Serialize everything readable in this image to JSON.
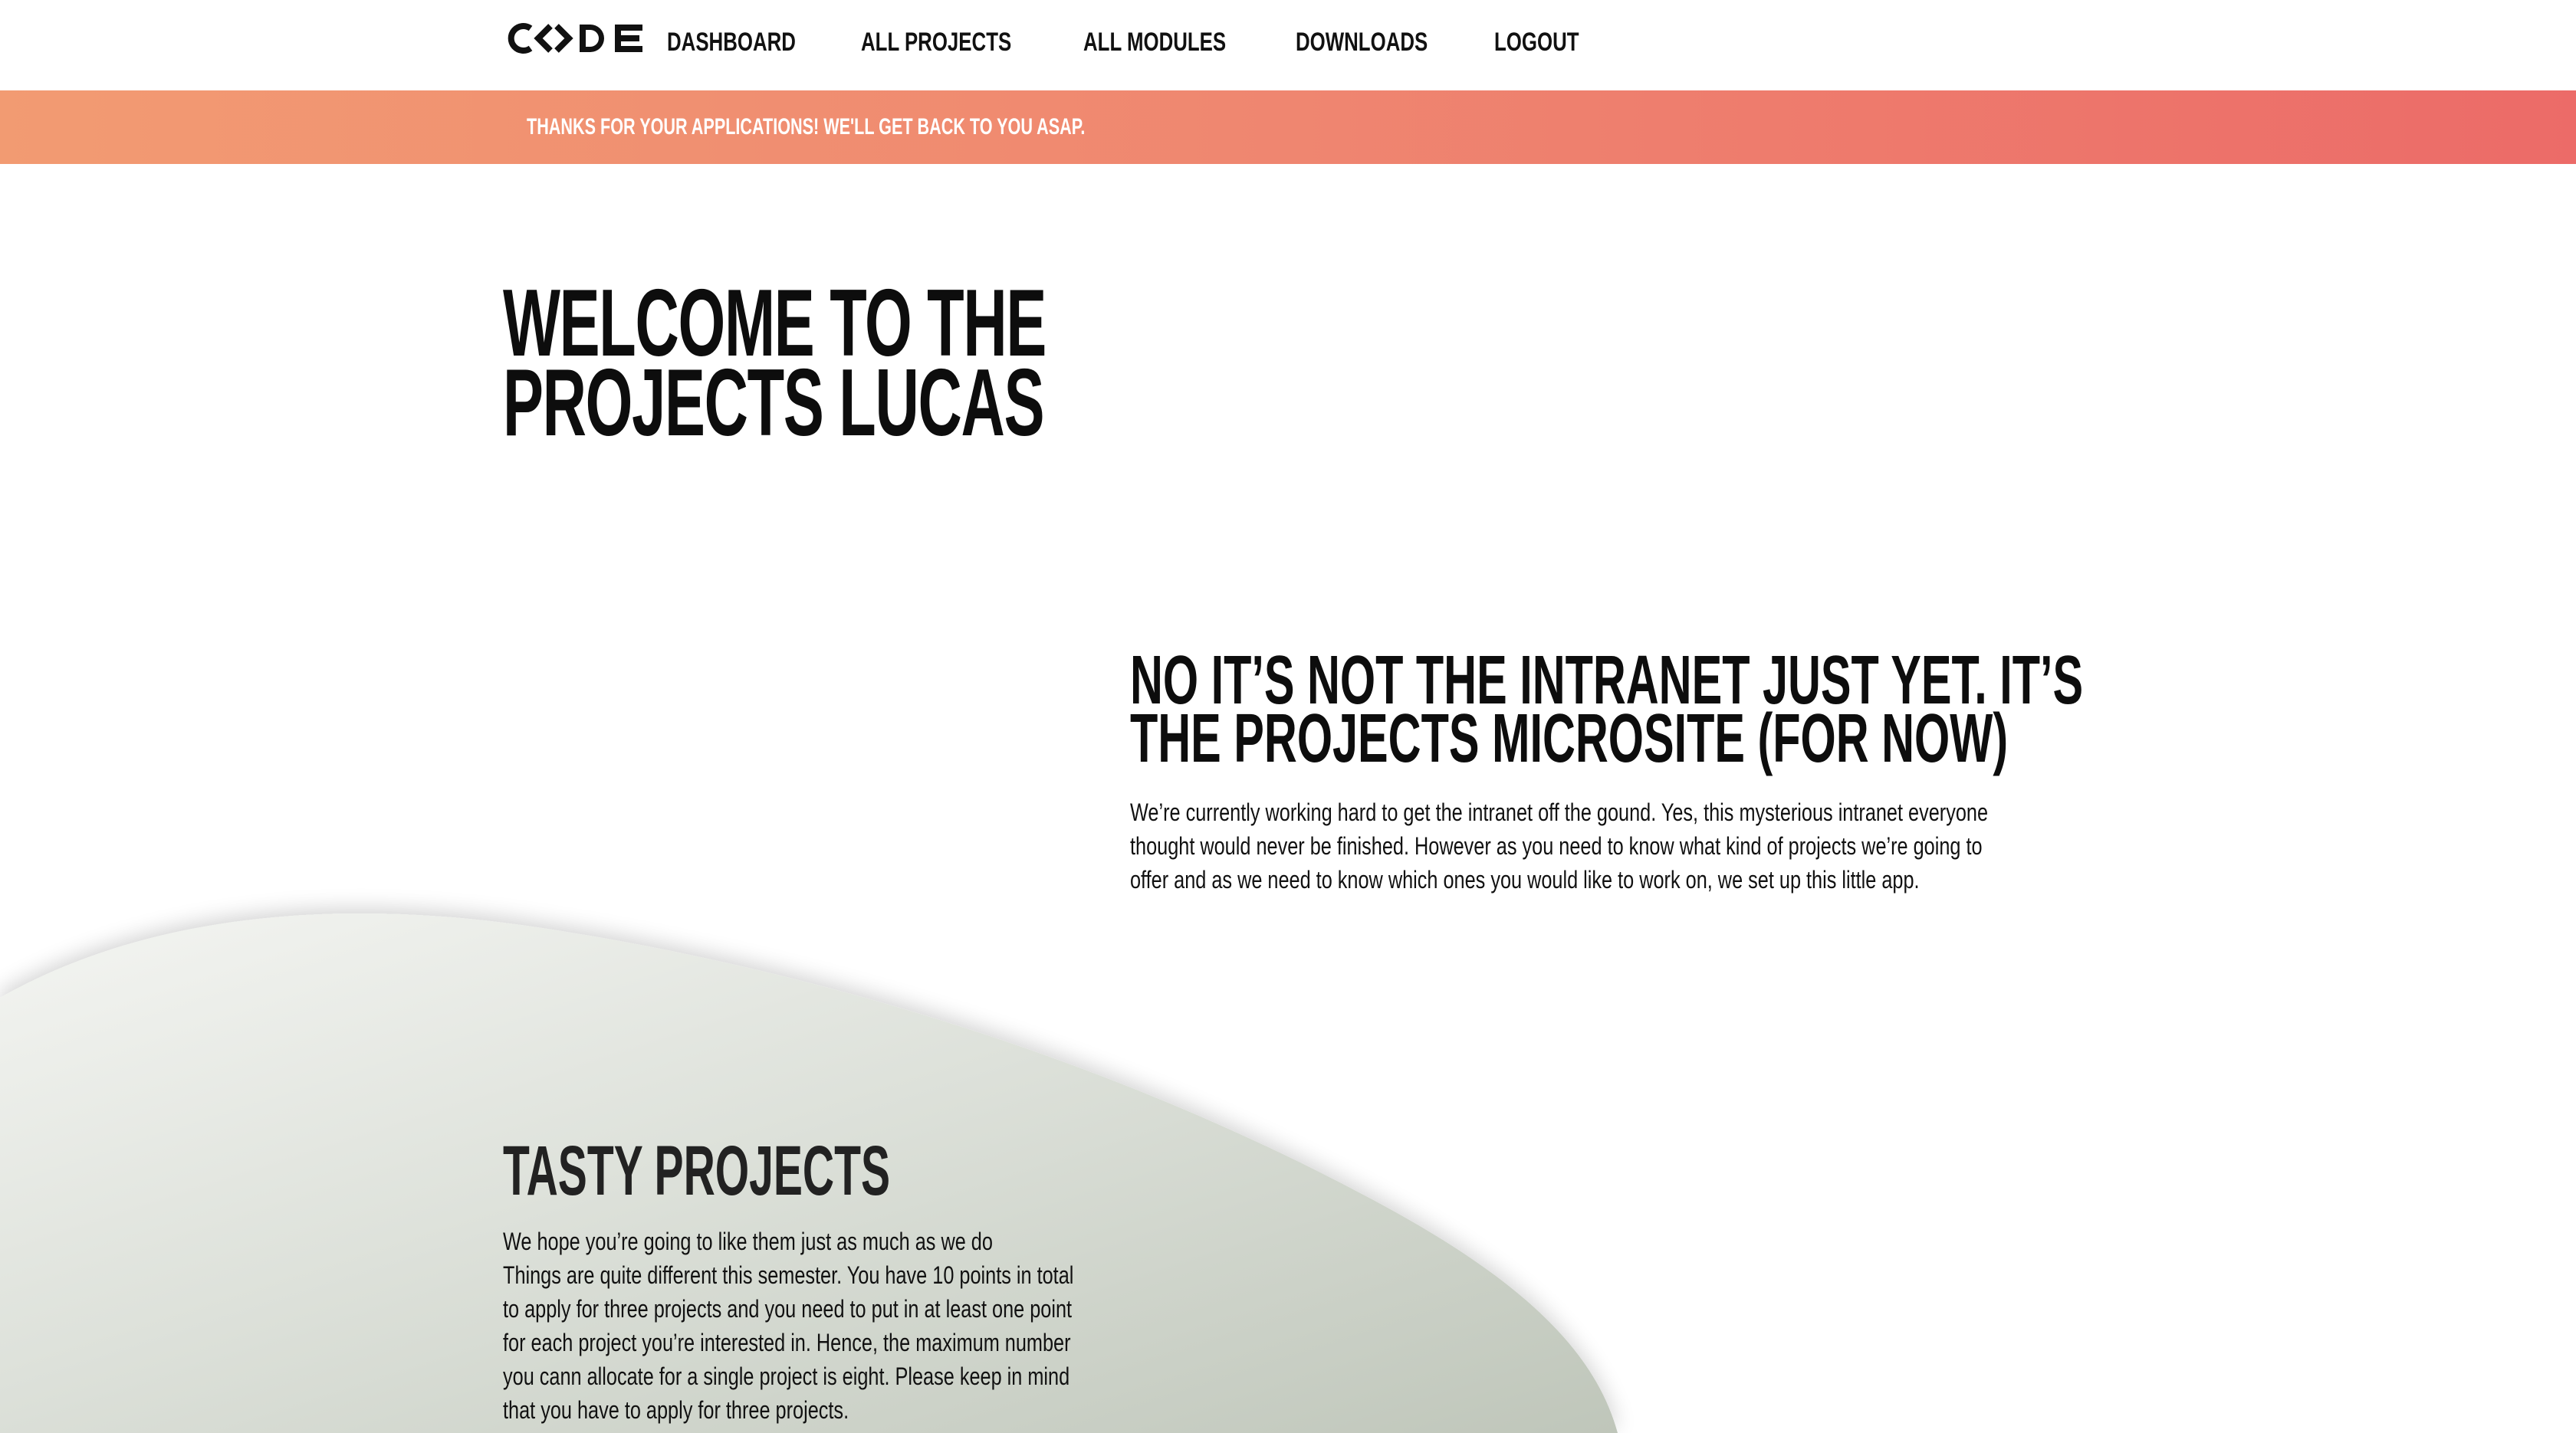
{
  "header": {
    "logo_text": "CODE",
    "nav": [
      {
        "label": "Dashboard"
      },
      {
        "label": "All projects"
      },
      {
        "label": "All modules"
      },
      {
        "label": "Downloads"
      },
      {
        "label": "Logout"
      }
    ]
  },
  "banner": {
    "message": "Thanks for your applications! We'll get back to you asap."
  },
  "hero": {
    "title_lines": [
      "Welcome to the",
      "projects Lucas"
    ]
  },
  "intro": {
    "title_lines": [
      "No it’s not the intranet just yet. It’s",
      "the projects microsite (for now)"
    ],
    "body_lines": [
      "We’re currently working hard to get the intranet off the gound. Yes, this mysterious intranet everyone",
      "thought would never be finished. However as you need to know what kind of projects we’re going to",
      "offer and as we need to know which ones you would like to work on, we set up this little app."
    ]
  },
  "tasty": {
    "title": "Tasty projects",
    "body_lines": [
      "We hope you’re going to like them just as much as we do",
      "Things are quite different this semester. You have 10 points in total",
      "to apply for three projects and you need to put in at least one point",
      "for each project you’re interested in. Hence, the maximum number",
      "you cann allocate for a single project is eight. Please keep in mind",
      "that you have to apply for three projects."
    ]
  },
  "colors": {
    "banner_start": "#f29b72",
    "banner_end": "#ec6b68",
    "blob_light": "#eef0ec",
    "blob_dark": "#c5cbc0",
    "text": "#111111"
  }
}
